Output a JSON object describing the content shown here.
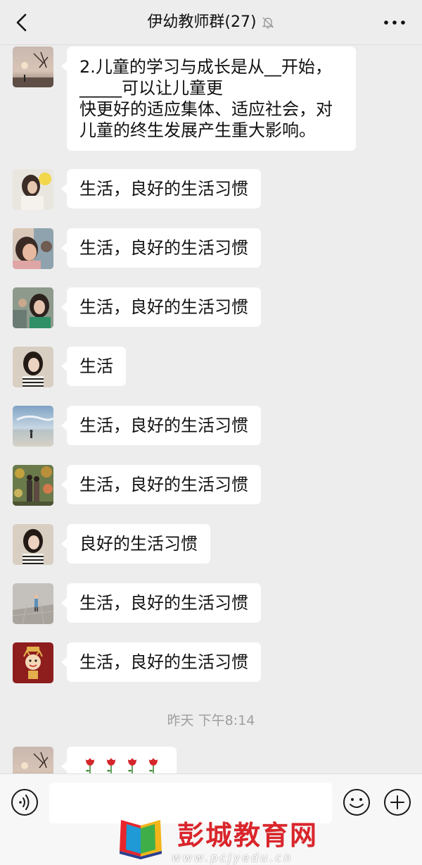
{
  "header": {
    "title": "伊幼教师群(27)"
  },
  "messages": [
    {
      "lines": [
        "2.儿童的学习与成长是从__开始，",
        "_____可以让儿童更",
        "快更好的适应集体、适应社会，对",
        "儿童的终生发展产生重大影响。"
      ]
    },
    {
      "text": "生活，良好的生活习惯"
    },
    {
      "text": "生活，良好的生活习惯"
    },
    {
      "text": "生活，良好的生活习惯"
    },
    {
      "text": "生活"
    },
    {
      "text": "生活，良好的生活习惯"
    },
    {
      "text": "生活，良好的生活习惯"
    },
    {
      "text": "良好的生活习惯"
    },
    {
      "text": "生活，良好的生活习惯"
    },
    {
      "text": "生活，良好的生活习惯"
    }
  ],
  "time_separator": "昨天 下午8:14",
  "last_message": {
    "emoji": [
      "rose",
      "rose",
      "rose",
      "rose"
    ]
  },
  "input": {
    "value": ""
  },
  "watermark": {
    "text": "彭城教育网",
    "url": "www.pcjyedu.cn"
  },
  "colors": {
    "background": "#ededed",
    "bubble": "#ffffff",
    "watermark_red": "#d9262c"
  }
}
